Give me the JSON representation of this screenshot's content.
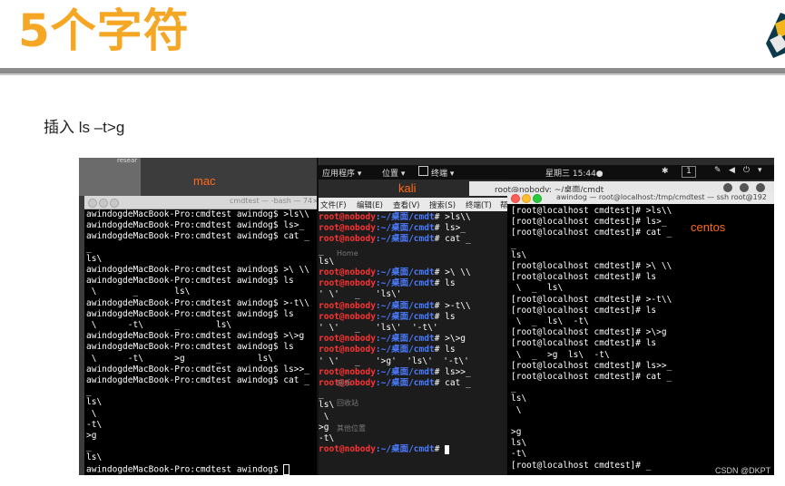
{
  "slide": {
    "title": "5个字符",
    "subtitle": "插入 ls –t>g"
  },
  "mac": {
    "label": "mac",
    "window_title": "cmdtest — -bash — 74×2",
    "bg_text": "resear",
    "lines": [
      "awindogdeMacBook-Pro:cmdtest awindog$ >ls\\\\",
      "awindogdeMacBook-Pro:cmdtest awindog$ ls>_",
      "awindogdeMacBook-Pro:cmdtest awindog$ cat _",
      "_",
      "ls\\",
      "awindogdeMacBook-Pro:cmdtest awindog$ >\\ \\\\",
      "awindogdeMacBook-Pro:cmdtest awindog$ ls",
      " \\       _       ls\\",
      "awindogdeMacBook-Pro:cmdtest awindog$ >-t\\\\",
      "awindogdeMacBook-Pro:cmdtest awindog$ ls",
      " \\      -t\\      _       ls\\",
      "awindogdeMacBook-Pro:cmdtest awindog$ >\\>g",
      "awindogdeMacBook-Pro:cmdtest awindog$ ls",
      " \\      -t\\      >g      _       ls\\",
      "awindogdeMacBook-Pro:cmdtest awindog$ ls>>_",
      "awindogdeMacBook-Pro:cmdtest awindog$ cat _",
      "_",
      "ls\\",
      " \\",
      "-t\\",
      ">g",
      "_",
      "ls\\"
    ],
    "prompt_last": "awindogdeMacBook-Pro:cmdtest awindog$ "
  },
  "gnome": {
    "apps": "应用程序 ▾",
    "places": "位置 ▾",
    "terminal": "终端 ▾",
    "clock": "星期三 15:44●",
    "workspace": "1"
  },
  "kali": {
    "label": "kali",
    "window_title": "root@nobody: ~/桌面/cmdt",
    "menu": [
      "文件(F)",
      "编辑(E)",
      "查看(V)",
      "搜索(S)",
      "终端(T)",
      "帮"
    ],
    "prompt_user": "root@nobody",
    "prompt_path": ":~/桌面/cmdt",
    "lines": [
      {
        "t": "p",
        "cmd": "# >ls\\\\"
      },
      {
        "t": "p",
        "cmd": "# ls>_"
      },
      {
        "t": "p",
        "cmd": "# cat _"
      },
      {
        "t": "o",
        "text": "_"
      },
      {
        "t": "o",
        "text": "ls\\"
      },
      {
        "t": "p",
        "cmd": "# >\\ \\\\"
      },
      {
        "t": "p",
        "cmd": "# ls"
      },
      {
        "t": "o",
        "text": "' \\'   _   'ls\\'"
      },
      {
        "t": "p",
        "cmd": "# >-t\\\\"
      },
      {
        "t": "p",
        "cmd": "# ls"
      },
      {
        "t": "o",
        "text": "' \\'   _   'ls\\'  '-t\\'"
      },
      {
        "t": "p",
        "cmd": "# >\\>g"
      },
      {
        "t": "p",
        "cmd": "# ls"
      },
      {
        "t": "o",
        "text": "' \\'   _   '>g'  'ls\\'  '-t\\'"
      },
      {
        "t": "p",
        "cmd": "# ls>>_"
      },
      {
        "t": "p",
        "cmd": "# cat _"
      },
      {
        "t": "o",
        "text": "_"
      },
      {
        "t": "o",
        "text": "ls\\"
      },
      {
        "t": "o",
        "text": " \\"
      },
      {
        "t": "o",
        "text": ">g"
      },
      {
        "t": "o",
        "text": "-t\\"
      }
    ],
    "ghost": [
      "Home",
      "音乐",
      "回收站",
      "其他位置"
    ]
  },
  "centos": {
    "label": "centos",
    "window_title": "awindog — root@localhost:/tmp/cmdtest — ssh root@192",
    "lines": [
      "[root@localhost cmdtest]# >ls\\\\",
      "[root@localhost cmdtest]# ls>_",
      "[root@localhost cmdtest]# cat _",
      "_",
      "ls\\",
      "[root@localhost cmdtest]# >\\ \\\\",
      "[root@localhost cmdtest]# ls",
      " \\  _  ls\\",
      "[root@localhost cmdtest]# >-t\\\\",
      "[root@localhost cmdtest]# ls",
      " \\  _  ls\\  -t\\",
      "[root@localhost cmdtest]# >\\>g",
      "[root@localhost cmdtest]# ls",
      " \\  _  >g  ls\\  -t\\",
      "[root@localhost cmdtest]# ls>>_",
      "[root@localhost cmdtest]# cat _",
      "_",
      "ls\\",
      " \\",
      "",
      ">g",
      "ls\\",
      "-t\\",
      "[root@localhost cmdtest]# _"
    ]
  },
  "watermark": "CSDN @DKPT"
}
